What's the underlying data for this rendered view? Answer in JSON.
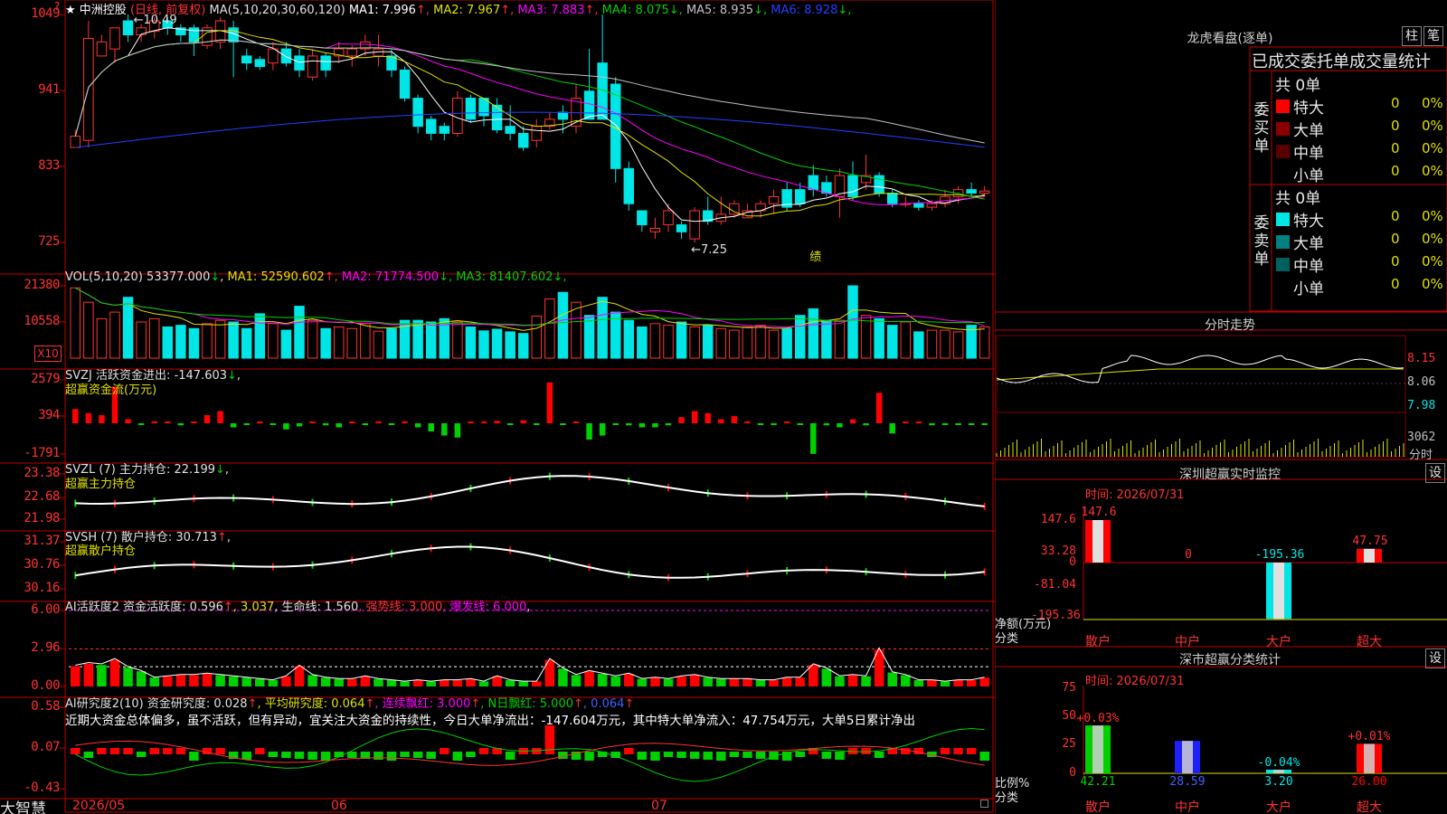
{
  "app": {
    "logo": "大智慧"
  },
  "colors": {
    "up": "#ff3232",
    "down": "#00e5e5",
    "ma1": "#ffffff",
    "ma2": "#e0e000",
    "ma3": "#ff00ff",
    "ma4": "#00d000",
    "ma5": "#c0c0c0",
    "ma6": "#2040ff"
  },
  "kline": {
    "star": "★",
    "stock_name": "中洲控股",
    "period": "(日线, 前复权)",
    "ma_header": "MA(5,10,20,30,60,120)",
    "ma": [
      {
        "label": "MA1:",
        "value": "7.996",
        "arrow": "↑"
      },
      {
        "label": "MA2:",
        "value": "7.967",
        "arrow": "↑"
      },
      {
        "label": "MA3:",
        "value": "7.883",
        "arrow": "↑"
      },
      {
        "label": "MA4:",
        "value": "8.075",
        "arrow": "↓"
      },
      {
        "label": "MA5:",
        "value": "8.935",
        "arrow": "↓"
      },
      {
        "label": "MA6:",
        "value": "8.928",
        "arrow": "↓"
      }
    ],
    "y_ticks": [
      "1049",
      "941",
      "833",
      "725"
    ],
    "high_label": "10.49",
    "low_label": "7.25",
    "event_mark": "绩",
    "arrow_mark": "?",
    "candles": [
      [
        8.6,
        8.76,
        8.6,
        8.85
      ],
      [
        8.7,
        10.15,
        8.6,
        10.4
      ],
      [
        9.9,
        10.1,
        9.9,
        10.2
      ],
      [
        10,
        10.3,
        9.8,
        10.3
      ],
      [
        10.4,
        10.2,
        10.1,
        10.49
      ],
      [
        10.2,
        10.3,
        10.1,
        10.35
      ],
      [
        10.25,
        10.4,
        10.15,
        10.45
      ],
      [
        10.4,
        10.3,
        10.2,
        10.45
      ],
      [
        10.3,
        10.2,
        10.1,
        10.35
      ],
      [
        10.3,
        10.1,
        9.9,
        10.35
      ],
      [
        10.05,
        10.3,
        10,
        10.35
      ],
      [
        10.1,
        10.4,
        10,
        10.45
      ],
      [
        10.3,
        10.1,
        9.6,
        10.4
      ],
      [
        9.9,
        9.8,
        9.7,
        10.0
      ],
      [
        9.85,
        9.75,
        9.7,
        9.9
      ],
      [
        9.8,
        10.0,
        9.7,
        10.1
      ],
      [
        10,
        9.8,
        9.75,
        10.1
      ],
      [
        9.9,
        9.7,
        9.6,
        10.0
      ],
      [
        9.6,
        9.9,
        9.55,
        10.0
      ],
      [
        9.9,
        9.7,
        9.6,
        9.95
      ],
      [
        9.9,
        10.0,
        9.8,
        10.1
      ],
      [
        9.9,
        10.0,
        9.75,
        10.05
      ],
      [
        10,
        10.1,
        9.9,
        10.2
      ],
      [
        9.9,
        10.0,
        9.75,
        10.2
      ],
      [
        9.9,
        9.7,
        9.6,
        10.0
      ],
      [
        9.7,
        9.3,
        9.25,
        9.75
      ],
      [
        9.3,
        8.9,
        8.8,
        9.35
      ],
      [
        9.0,
        8.8,
        8.7,
        9.05
      ],
      [
        8.9,
        8.8,
        8.7,
        8.95
      ],
      [
        8.8,
        9.3,
        8.75,
        9.4
      ],
      [
        9.3,
        9.0,
        8.95,
        9.35
      ],
      [
        9.3,
        9.05,
        8.9,
        9.3
      ],
      [
        9.2,
        8.85,
        8.8,
        9.3
      ],
      [
        8.9,
        8.8,
        8.7,
        9.2
      ],
      [
        8.8,
        8.6,
        8.55,
        8.9
      ],
      [
        8.7,
        8.9,
        8.6,
        9.0
      ],
      [
        8.9,
        9.0,
        8.85,
        9.1
      ],
      [
        9.1,
        9.0,
        8.8,
        9.2
      ],
      [
        8.9,
        9.3,
        8.8,
        9.5
      ],
      [
        9.4,
        9.0,
        9.3,
        10.0
      ],
      [
        9.8,
        9.0,
        9.0,
        10.49
      ],
      [
        9.5,
        8.3,
        8.1,
        9.6
      ],
      [
        8.3,
        7.8,
        7.7,
        8.4
      ],
      [
        7.7,
        7.5,
        7.4,
        7.7
      ],
      [
        7.4,
        7.45,
        7.3,
        7.6
      ],
      [
        7.5,
        7.7,
        7.4,
        7.8
      ],
      [
        7.5,
        7.4,
        7.3,
        7.55
      ],
      [
        7.3,
        7.7,
        7.25,
        7.75
      ],
      [
        7.7,
        7.55,
        7.5,
        7.9
      ],
      [
        7.55,
        7.65,
        7.5,
        7.9
      ],
      [
        7.65,
        7.8,
        7.6,
        7.85
      ],
      [
        7.6,
        7.7,
        7.6,
        7.8
      ],
      [
        7.7,
        7.8,
        7.6,
        7.85
      ],
      [
        7.8,
        7.9,
        7.65,
        8.0
      ],
      [
        8.0,
        7.75,
        7.7,
        8.1
      ],
      [
        8.0,
        7.8,
        7.75,
        8.1
      ],
      [
        8.2,
        8.0,
        7.9,
        8.35
      ],
      [
        8.1,
        7.95,
        7.9,
        8.2
      ],
      [
        7.9,
        8.2,
        7.6,
        8.3
      ],
      [
        8.2,
        7.9,
        7.85,
        8.4
      ],
      [
        8.1,
        8.2,
        8.0,
        8.5
      ],
      [
        8.2,
        7.95,
        7.9,
        8.25
      ],
      [
        7.95,
        7.8,
        7.75,
        8.0
      ],
      [
        7.8,
        7.8,
        7.75,
        7.9
      ],
      [
        7.8,
        7.75,
        7.7,
        7.85
      ],
      [
        7.75,
        7.8,
        7.7,
        7.85
      ],
      [
        7.8,
        7.9,
        7.75,
        8.0
      ],
      [
        7.9,
        8.0,
        7.8,
        8.05
      ],
      [
        8.0,
        7.95,
        7.9,
        8.1
      ],
      [
        7.95,
        7.98,
        7.9,
        8.05
      ]
    ]
  },
  "vol": {
    "header": "VOL(5,10,20)",
    "value": "53377.000",
    "arrow": "↓",
    "ma": [
      {
        "label": "MA1:",
        "value": "52590.602",
        "arrow": "↑"
      },
      {
        "label": "MA2:",
        "value": "71774.500",
        "arrow": "↓"
      },
      {
        "label": "MA3:",
        "value": "81407.602",
        "arrow": "↓"
      }
    ],
    "y_ticks": [
      "21380",
      "10558"
    ],
    "unit_label": "X10",
    "values": [
      21380,
      17000,
      12000,
      14000,
      18500,
      11000,
      12000,
      9500,
      10000,
      9000,
      10500,
      11500,
      11000,
      9000,
      13500,
      10500,
      8500,
      15800,
      11500,
      9000,
      9500,
      9000,
      10500,
      8200,
      9000,
      11500,
      11500,
      11000,
      12000,
      11000,
      9500,
      8300,
      8800,
      8000,
      7500,
      12800,
      18000,
      20000,
      17000,
      13000,
      18500,
      14000,
      11500,
      9500,
      10500,
      10000,
      11000,
      9500,
      10000,
      9000,
      8500,
      9500,
      10000,
      8500,
      9000,
      13000,
      15000,
      11500,
      11500,
      22000,
      13000,
      12000,
      10000,
      11000,
      8000,
      8500,
      8500,
      8000,
      10000,
      9500,
      8800
    ]
  },
  "svzj": {
    "header": "SVZJ",
    "title": "活跃资金进出:",
    "value": "-147.603",
    "arrow": "↓",
    "subtitle": "超赢资金流(万元)",
    "y_ticks": [
      "2579",
      "394",
      "-1791"
    ],
    "values": [
      700,
      500,
      400,
      1800,
      200,
      -80,
      30,
      10,
      -100,
      20,
      400,
      600,
      -200,
      -50,
      0,
      -50,
      -300,
      -150,
      50,
      -100,
      -200,
      50,
      -80,
      40,
      -30,
      80,
      -200,
      -400,
      -600,
      -700,
      40,
      20,
      120,
      -80,
      150,
      -60,
      2000,
      -80,
      20,
      -800,
      -600,
      -40,
      -100,
      -200,
      -200,
      -100,
      300,
      600,
      500,
      200,
      350,
      60,
      -70,
      -40,
      40,
      -30,
      -1500,
      -100,
      -200,
      200,
      -100,
      1500,
      -500,
      10,
      40,
      -100,
      -50,
      -40,
      -80,
      -30,
      -70,
      -60,
      -100
    ]
  },
  "svzl": {
    "header": "SVZL (7)",
    "title": "主力持仓:",
    "value": "22.199",
    "arrow": "↓",
    "subtitle": "超赢主力持仓",
    "y_ticks": [
      "23.38",
      "22.68",
      "21.98"
    ]
  },
  "svsh": {
    "header": "SVSH (7)",
    "title": "散户持仓:",
    "value": "30.713",
    "arrow": "↑",
    "subtitle": "超赢散户持仓",
    "y_ticks": [
      "31.37",
      "30.76",
      "30.16"
    ]
  },
  "ai_active": {
    "header": "AI活跃度2",
    "items": [
      {
        "text": "资金活跃度: 0.596",
        "color": "#e0e0e0"
      },
      {
        "text": "↑",
        "color": "#ff3232"
      },
      {
        "text": ", 3.037",
        "color": "#e0e000"
      },
      {
        "text": ", 生命线: 1.560",
        "color": "#e0e0e0"
      },
      {
        "text": ", 强势线: 3.000",
        "color": "#ff3232"
      },
      {
        "text": ", 爆发线: 6.000",
        "color": "#ff00ff"
      },
      {
        "text": ",",
        "color": "#e0e0e0"
      }
    ],
    "y_ticks": [
      "6.00",
      "2.96",
      "0.00"
    ],
    "values": [
      1.6,
      1.8,
      1.7,
      2.1,
      1.5,
      1.2,
      0.7,
      0.8,
      0.9,
      0.9,
      1.0,
      0.9,
      0.8,
      0.7,
      0.6,
      0.5,
      0.8,
      1.6,
      0.9,
      0.7,
      0.6,
      0.6,
      0.8,
      0.6,
      0.5,
      0.4,
      0.5,
      0.4,
      0.5,
      0.5,
      0.6,
      0.4,
      0.8,
      0.5,
      0.4,
      0.4,
      2.1,
      1.4,
      0.9,
      1.2,
      1.0,
      0.8,
      1.0,
      0.6,
      0.7,
      0.6,
      0.8,
      0.9,
      0.7,
      0.6,
      0.6,
      0.6,
      0.5,
      0.5,
      0.7,
      0.7,
      1.7,
      1.4,
      0.8,
      0.9,
      0.8,
      2.9,
      1.1,
      0.9,
      0.5,
      0.5,
      0.4,
      0.5,
      0.5,
      0.7,
      0.6,
      0.6
    ]
  },
  "ai_research": {
    "header": "AI研究度2(10)",
    "items": [
      {
        "text": "资金研究度: 0.028",
        "color": "#e0e0e0"
      },
      {
        "text": "↑",
        "color": "#ff3232"
      },
      {
        "text": ", 平均研究度: 0.064",
        "color": "#e0e000"
      },
      {
        "text": "↑",
        "color": "#ff3232"
      },
      {
        "text": ", 连续飘红: 3.000",
        "color": "#ff00ff"
      },
      {
        "text": "↑",
        "color": "#ff3232"
      },
      {
        "text": ", N日飘红: 5.000",
        "color": "#00d000"
      },
      {
        "text": "↑",
        "color": "#ff3232"
      },
      {
        "text": ", 0.064",
        "color": "#4060ff"
      },
      {
        "text": "↑",
        "color": "#ff3232"
      }
    ],
    "comment": "近期大资金总体偏多，虽不活跃，但有异动，宜关注大资金的持续性，今日大单净流出：-147.604万元，其中特大单净流入：47.754万元，大单5日累计净出",
    "y_ticks": [
      "0.58",
      "0.07",
      "-0.43"
    ]
  },
  "x_axis": [
    "2026/05",
    "06",
    "07"
  ],
  "order_panel": {
    "title": "龙虎看盘(逐单)",
    "btn_bar": "柱",
    "btn_line": "笔",
    "heading": "已成交委托单成交量统计",
    "buy_label": "委买单",
    "sell_label": "委卖单",
    "buy_total": "共 0单",
    "sell_total": "共 0单",
    "buy_rows": [
      {
        "name": "特大",
        "count": "0",
        "pct": "0%",
        "color": "#ff0000"
      },
      {
        "name": "大单",
        "count": "0",
        "pct": "0%",
        "color": "#8a0000"
      },
      {
        "name": "中单",
        "count": "0",
        "pct": "0%",
        "color": "#5a0000"
      },
      {
        "name": "小单",
        "count": "0",
        "pct": "0%",
        "color": ""
      }
    ],
    "sell_rows": [
      {
        "name": "特大",
        "count": "0",
        "pct": "0%",
        "color": "#00e5e5"
      },
      {
        "name": "大单",
        "count": "0",
        "pct": "0%",
        "color": "#008080"
      },
      {
        "name": "中单",
        "count": "0",
        "pct": "0%",
        "color": "#006060"
      },
      {
        "name": "小单",
        "count": "0",
        "pct": "0%",
        "color": ""
      }
    ]
  },
  "intraday": {
    "title": "分时走势",
    "y_ticks": [
      "8.15",
      "8.06",
      "7.98"
    ],
    "vol_tick": "3062",
    "vol_label": "分时"
  },
  "monitor": {
    "title": "深圳超赢实时监控",
    "btn": "设",
    "time": "时间: 2026/07/31",
    "y_ticks": [
      "147.6",
      "33.28",
      "0",
      "-81.04",
      "-195.36"
    ],
    "unit": "净额(万元)",
    "cat_label": "分类",
    "categories": [
      "散户",
      "中户",
      "大户",
      "超大"
    ],
    "values": [
      147.6,
      0,
      -195.36,
      47.75
    ],
    "labels": [
      "147.6",
      "0",
      "-195.36",
      "47.75"
    ]
  },
  "classify": {
    "title": "深市超赢分类统计",
    "btn": "设",
    "time": "时间: 2026/07/31",
    "y_ticks": [
      "75",
      "50",
      "25",
      "0"
    ],
    "unit": "比例%",
    "cat_label": "分类",
    "categories": [
      "散户",
      "中户",
      "大户",
      "超大"
    ],
    "values": [
      42.21,
      28.59,
      3.2,
      26.0
    ],
    "labels": [
      "42.21",
      "28.59",
      "3.20",
      "26.00"
    ],
    "changes": [
      "+0.03%",
      "",
      "-0.04%",
      "+0.01%"
    ]
  }
}
